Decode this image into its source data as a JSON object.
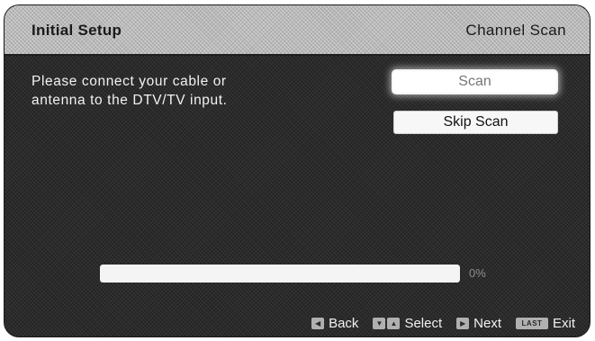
{
  "header": {
    "title": "Initial Setup",
    "section": "Channel Scan"
  },
  "message": {
    "line1": "Please connect your cable or",
    "line2": "antenna to the DTV/TV input."
  },
  "buttons": {
    "scan": "Scan",
    "skip_scan": "Skip Scan"
  },
  "progress": {
    "value": 0,
    "label": "0%"
  },
  "footer": {
    "back": "Back",
    "select": "Select",
    "next": "Next",
    "exit_key": "LAST",
    "exit": "Exit"
  },
  "icons": {
    "back": "left-arrow-key-icon",
    "select": "up-down-arrow-keys-icon",
    "next": "right-arrow-key-icon",
    "exit": "last-key-icon"
  },
  "colors": {
    "background": "#2b2b2b",
    "header": "#b9b9b9",
    "text": "#f2f2f2"
  }
}
